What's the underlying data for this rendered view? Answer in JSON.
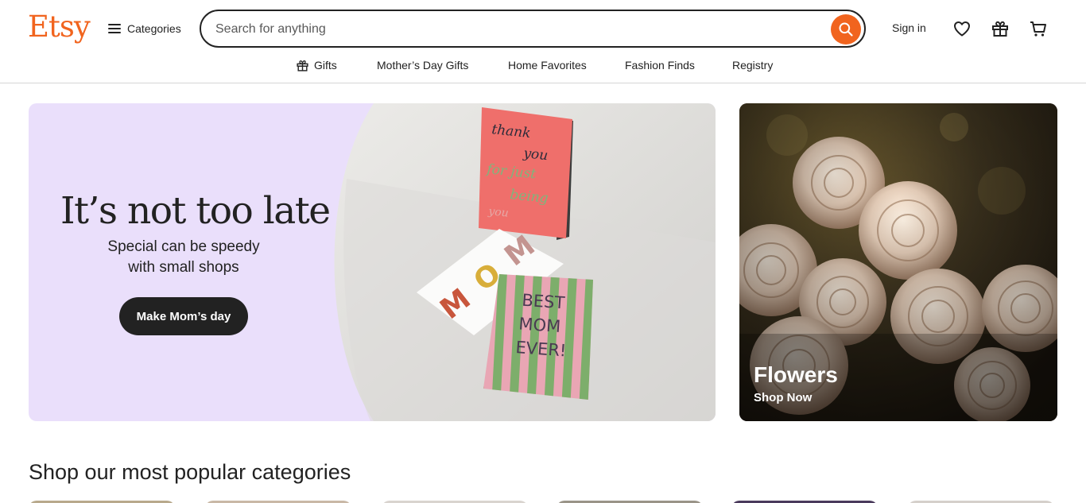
{
  "header": {
    "logo": "Etsy",
    "categories_label": "Categories",
    "search": {
      "placeholder": "Search for anything",
      "value": ""
    },
    "sign_in": "Sign in",
    "icons": [
      "favorites-heart-icon",
      "gift-icon",
      "cart-icon"
    ]
  },
  "subnav": {
    "items": [
      {
        "label": "Gifts",
        "icon": "gift-icon"
      },
      {
        "label": "Mother’s Day Gifts"
      },
      {
        "label": "Home Favorites"
      },
      {
        "label": "Fashion Finds"
      },
      {
        "label": "Registry"
      }
    ]
  },
  "hero": {
    "title": "It’s not too late",
    "subtitle_line1": "Special can be speedy",
    "subtitle_line2": "with small shops",
    "cta": "Make Mom’s day",
    "card_text": {
      "pink_card": "thank you for just being you",
      "mom_card": "MOM",
      "striped_card_line1": "BEST",
      "striped_card_line2": "MOM",
      "striped_card_line3": "EVER!"
    }
  },
  "promo": {
    "title": "Flowers",
    "link": "Shop Now"
  },
  "popular": {
    "title": "Shop our most popular categories"
  },
  "colors": {
    "brand": "#F1641E",
    "hero_bg": "#EADFFB",
    "text": "#222222"
  }
}
